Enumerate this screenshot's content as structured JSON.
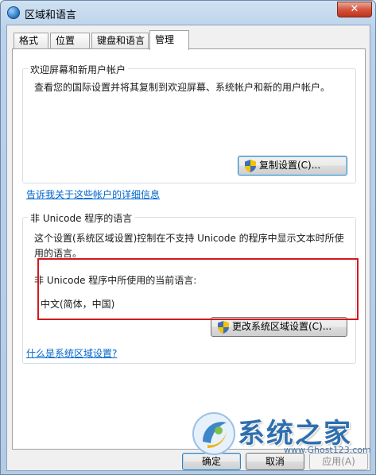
{
  "window": {
    "title": "区域和语言",
    "close_label": "✕"
  },
  "tabs": [
    {
      "label": "格式"
    },
    {
      "label": "位置"
    },
    {
      "label": "键盘和语言"
    },
    {
      "label": "管理"
    }
  ],
  "welcome_group": {
    "legend": "欢迎屏幕和新用户帐户",
    "description": "查看您的国际设置并将其复制到欢迎屏幕、系统帐户和新的用户帐户。",
    "copy_button": "复制设置(C)...",
    "link": "告诉我关于这些帐户的详细信息"
  },
  "unicode_group": {
    "legend": "非 Unicode 程序的语言",
    "description_line1": "这个设置(系统区域设置)控制在不支持 Unicode 的程序中显示文本时所使",
    "description_line2": "用的语言。",
    "current_label": "非 Unicode 程序中所使用的当前语言:",
    "current_value": "中文(简体，中国)",
    "change_button": "更改系统区域设置(C)...",
    "link": "什么是系统区域设置?"
  },
  "buttons": {
    "ok": "确定",
    "cancel": "取消",
    "apply": "应用(A)"
  },
  "watermark": {
    "text": "系统之家",
    "url": "www.Ghost123.com"
  },
  "colors": {
    "highlight_border": "#d2191d",
    "link": "#0066cc",
    "close_button": "#c0321c"
  }
}
